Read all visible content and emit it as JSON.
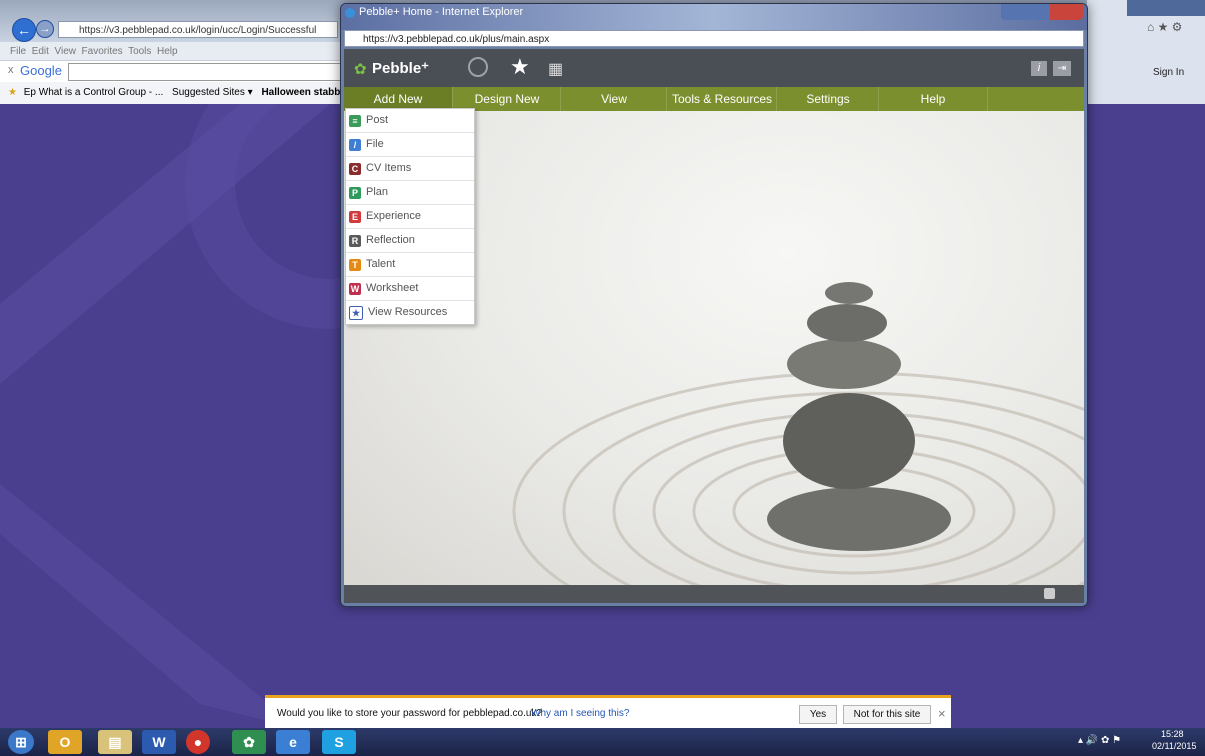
{
  "background_browser": {
    "url": "https://v3.pebblepad.co.uk/login/ucc/Login/Successful",
    "menu": [
      "File",
      "Edit",
      "View",
      "Favorites",
      "Tools",
      "Help"
    ],
    "google_label": "Google",
    "favorites": [
      "Ep What is a Control Group - ...",
      "Suggested Sites ▾",
      "Halloween stabbings"
    ],
    "sign_in": "Sign In"
  },
  "popup": {
    "title": "Pebble+ Home - Internet Explorer",
    "url": "https://v3.pebblepad.co.uk/plus/main.aspx",
    "brand": "Pebble⁺",
    "nav": [
      "Add New",
      "Design New",
      "View",
      "Tools & Resources",
      "Settings",
      "Help"
    ],
    "dropdown": [
      {
        "label": "Post",
        "icon": "post-icon",
        "color": "#3a9a5a"
      },
      {
        "label": "File",
        "icon": "file-icon",
        "color": "#3f7ed3"
      },
      {
        "label": "CV Items",
        "icon": "cv-icon",
        "color": "#8a2c2c"
      },
      {
        "label": "Plan",
        "icon": "plan-icon",
        "color": "#2f9a5c"
      },
      {
        "label": "Experience",
        "icon": "experience-icon",
        "color": "#d23b3b"
      },
      {
        "label": "Reflection",
        "icon": "reflection-icon",
        "color": "#5a5a5a"
      },
      {
        "label": "Talent",
        "icon": "talent-icon",
        "color": "#e68a16"
      },
      {
        "label": "Worksheet",
        "icon": "worksheet-icon",
        "color": "#c0304e"
      },
      {
        "label": "View Resources",
        "icon": "star-icon",
        "color": "#3f5fb5"
      }
    ]
  },
  "notification": {
    "message": "Would you like to store your password for pebblepad.co.uk?",
    "link": "Why am I seeing this?",
    "yes": "Yes",
    "no": "Not for this site",
    "close": "×"
  },
  "taskbar": {
    "time": "15:28",
    "date": "02/11/2015"
  }
}
